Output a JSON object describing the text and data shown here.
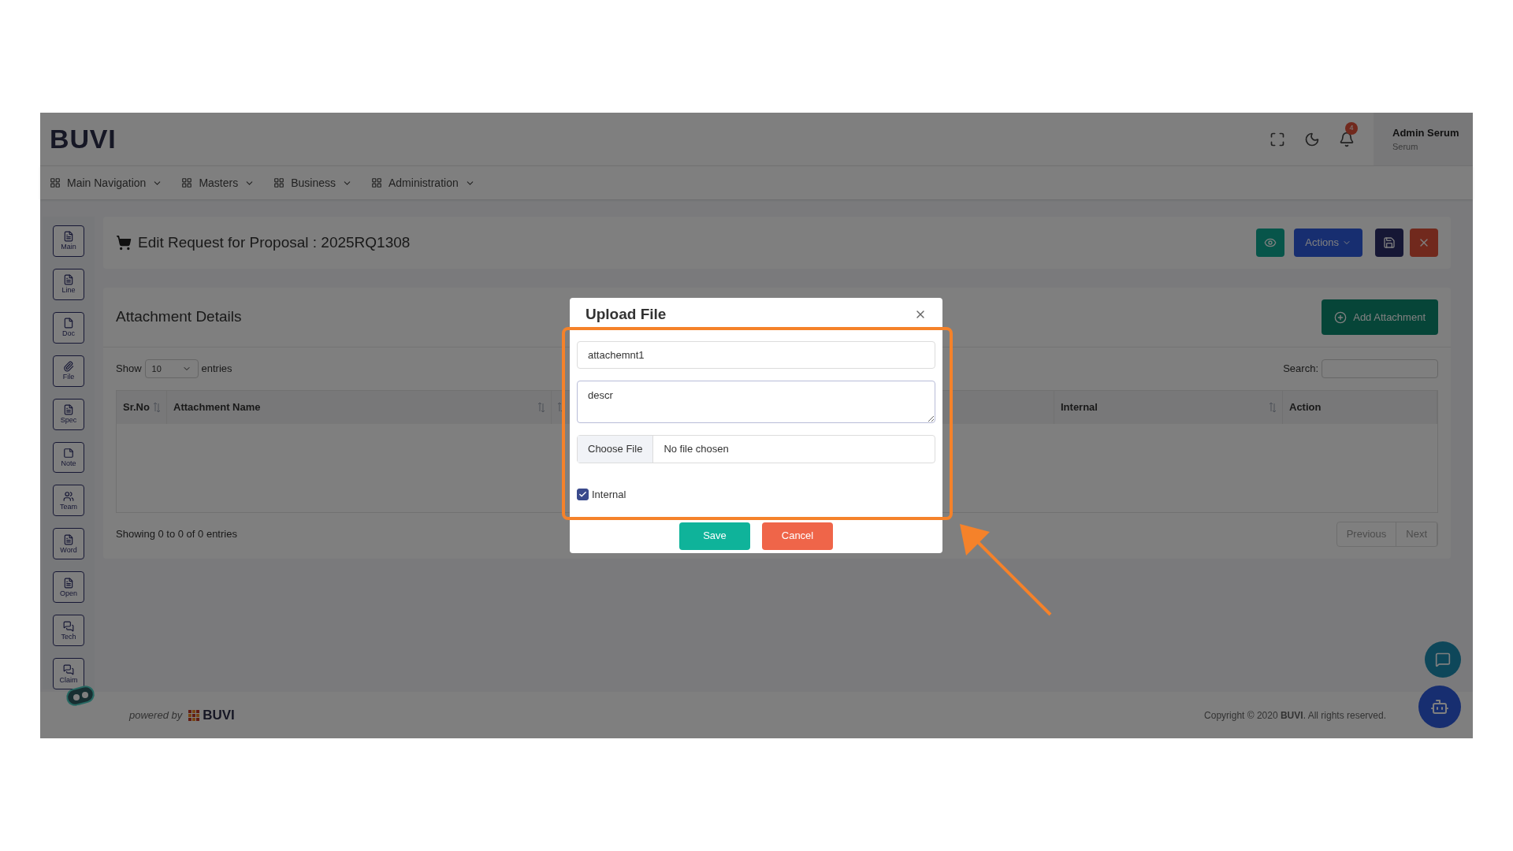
{
  "header": {
    "logo": "BUVI",
    "notification_count": "4",
    "user": {
      "name": "Admin Serum",
      "role": "Serum"
    }
  },
  "nav": [
    {
      "label": "Main Navigation"
    },
    {
      "label": "Masters"
    },
    {
      "label": "Business"
    },
    {
      "label": "Administration"
    }
  ],
  "sidebar": [
    {
      "label": "Main",
      "kind": "list"
    },
    {
      "label": "Line",
      "kind": "list"
    },
    {
      "label": "Doc",
      "kind": "page"
    },
    {
      "label": "File",
      "kind": "clip"
    },
    {
      "label": "Spec",
      "kind": "list"
    },
    {
      "label": "Note",
      "kind": "note"
    },
    {
      "label": "Team",
      "kind": "team"
    },
    {
      "label": "Word",
      "kind": "list"
    },
    {
      "label": "Open",
      "kind": "list"
    },
    {
      "label": "Tech",
      "kind": "chat"
    },
    {
      "label": "Claim",
      "kind": "chat"
    }
  ],
  "page_title": "Edit Request for Proposal : 2025RQ1308",
  "toolbar": {
    "actions": "Actions"
  },
  "attachments": {
    "title": "Attachment Details",
    "add_button": "Add Attachment",
    "show": "Show",
    "page_size": "10",
    "entries": "entries",
    "search_label": "Search:",
    "columns": [
      {
        "label": "Sr.No",
        "sortable": true
      },
      {
        "label": "Attachment Name",
        "sortable": true
      },
      {
        "sortable": true
      },
      {
        "label": "Internal",
        "sortable": true
      },
      {
        "label": "Action",
        "sortable": false
      }
    ],
    "info": "Showing 0 to 0 of 0 entries",
    "pagination": [
      {
        "label": "Previous",
        "disabled": true
      },
      {
        "label": "Next",
        "disabled": true
      }
    ]
  },
  "dialog": {
    "title": "Upload File",
    "name_value": "attachemnt1",
    "description_value": "descr",
    "choose_button": "Choose File",
    "file_status": "No file chosen",
    "internal": {
      "label": "Internal",
      "checked": true
    },
    "save": "Save",
    "cancel": "Cancel"
  },
  "footer": {
    "powered_by": "powered by",
    "brand": "BUVI",
    "copyright": "Copyright © 2020 **BUVI**. All rights reserved."
  }
}
